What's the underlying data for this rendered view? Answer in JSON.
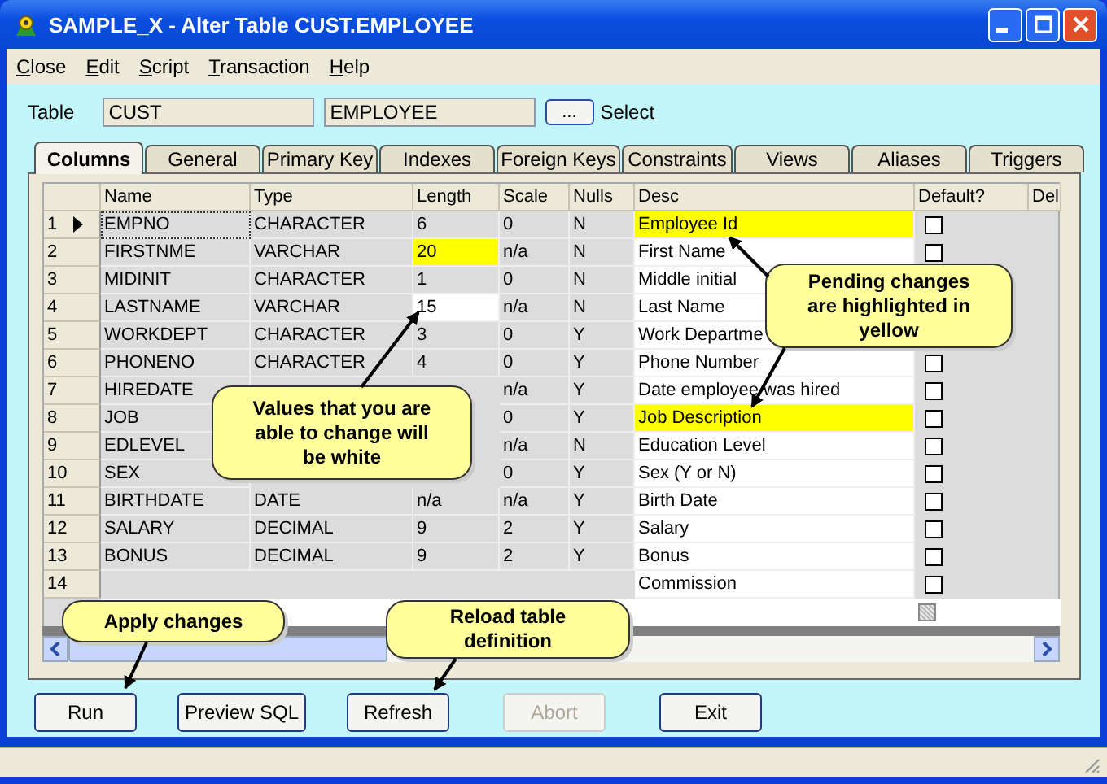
{
  "window": {
    "title": "SAMPLE_X - Alter Table CUST.EMPLOYEE"
  },
  "menu": [
    {
      "accel": "C",
      "rest": "lose"
    },
    {
      "accel": "E",
      "rest": "dit"
    },
    {
      "accel": "S",
      "rest": "cript"
    },
    {
      "accel": "T",
      "rest": "ransaction"
    },
    {
      "accel": "H",
      "rest": "elp"
    }
  ],
  "table_selector": {
    "label": "Table",
    "schema": "CUST",
    "table": "EMPLOYEE",
    "browse_button": "...",
    "browse_label": "Select"
  },
  "tabs": [
    {
      "label": "Columns",
      "selected": true
    },
    {
      "label": "General",
      "selected": false
    },
    {
      "label": "Primary Key",
      "selected": false
    },
    {
      "label": "Indexes",
      "selected": false
    },
    {
      "label": "Foreign Keys",
      "selected": false
    },
    {
      "label": "Constraints",
      "selected": false
    },
    {
      "label": "Views",
      "selected": false
    },
    {
      "label": "Aliases",
      "selected": false
    },
    {
      "label": "Triggers",
      "selected": false
    }
  ],
  "grid": {
    "columns": [
      "Name",
      "Type",
      "Length",
      "Scale",
      "Nulls",
      "Desc",
      "Default?",
      "Del"
    ],
    "rows": [
      {
        "num": "1",
        "current": true,
        "name": "EMPNO",
        "type": "CHARACTER",
        "length": "6",
        "length_editable": false,
        "length_pending": false,
        "scale": "0",
        "nulls": "N",
        "desc": "Employee Id",
        "desc_pending": true,
        "default": false
      },
      {
        "num": "2",
        "current": false,
        "name": "FIRSTNME",
        "type": "VARCHAR",
        "length": "20",
        "length_editable": true,
        "length_pending": true,
        "scale": "n/a",
        "nulls": "N",
        "desc": "First Name",
        "desc_pending": false,
        "default": false
      },
      {
        "num": "3",
        "current": false,
        "name": "MIDINIT",
        "type": "CHARACTER",
        "length": "1",
        "length_editable": false,
        "length_pending": false,
        "scale": "0",
        "nulls": "N",
        "desc": "Middle initial",
        "desc_pending": false
      },
      {
        "num": "4",
        "current": false,
        "name": "LASTNAME",
        "type": "VARCHAR",
        "length": "15",
        "length_editable": true,
        "length_pending": false,
        "scale": "n/a",
        "nulls": "N",
        "desc": "Last Name",
        "desc_pending": false
      },
      {
        "num": "5",
        "current": false,
        "name": "WORKDEPT",
        "type": "CHARACTER",
        "length": "3",
        "length_editable": false,
        "length_pending": false,
        "scale": "0",
        "nulls": "Y",
        "desc": "Work Departme",
        "desc_pending": false
      },
      {
        "num": "6",
        "current": false,
        "name": "PHONENO",
        "type": "CHARACTER",
        "length": "4",
        "length_editable": false,
        "length_pending": false,
        "scale": "0",
        "nulls": "Y",
        "desc": "Phone Number",
        "desc_pending": false,
        "default": false
      },
      {
        "num": "7",
        "current": false,
        "name": "HIREDATE",
        "scale": "n/a",
        "nulls": "Y",
        "desc": "Date employee was hired",
        "desc_pending": false,
        "default": false
      },
      {
        "num": "8",
        "current": false,
        "name": "JOB",
        "scale": "0",
        "nulls": "Y",
        "desc": "Job Description",
        "desc_pending": true,
        "default": false
      },
      {
        "num": "9",
        "current": false,
        "name": "EDLEVEL",
        "scale": "n/a",
        "nulls": "N",
        "desc": "Education Level",
        "desc_pending": false,
        "default": false
      },
      {
        "num": "10",
        "current": false,
        "name": "SEX",
        "scale": "0",
        "nulls": "Y",
        "desc": "Sex (Y or N)",
        "desc_pending": false,
        "default": false
      },
      {
        "num": "11",
        "current": false,
        "name": "BIRTHDATE",
        "type": "DATE",
        "length": "n/a",
        "length_editable": false,
        "length_pending": false,
        "scale": "n/a",
        "nulls": "Y",
        "desc": "Birth Date",
        "desc_pending": false,
        "default": false
      },
      {
        "num": "12",
        "current": false,
        "name": "SALARY",
        "type": "DECIMAL",
        "length": "9",
        "length_editable": false,
        "length_pending": false,
        "scale": "2",
        "nulls": "Y",
        "desc": "Salary",
        "desc_pending": false,
        "default": false
      },
      {
        "num": "13",
        "current": false,
        "name": "BONUS",
        "type": "DECIMAL",
        "length": "9",
        "length_editable": false,
        "length_pending": false,
        "scale": "2",
        "nulls": "Y",
        "desc": "Bonus",
        "desc_pending": false,
        "default": false
      },
      {
        "num": "14",
        "current": false,
        "desc": "Commission",
        "desc_pending": false,
        "default": false
      }
    ],
    "new_row": {
      "default_disabled": true
    }
  },
  "buttons": [
    {
      "label": "Run",
      "disabled": false
    },
    {
      "label": "Preview SQL",
      "disabled": false
    },
    {
      "label": "Refresh",
      "disabled": false
    },
    {
      "label": "Abort",
      "disabled": true
    },
    {
      "label": "Exit",
      "disabled": false
    }
  ],
  "callouts": [
    {
      "text": "Pending changes are highlighted in yellow"
    },
    {
      "text": "Values that you are able to change will be white"
    },
    {
      "text": "Apply changes"
    },
    {
      "text": "Reload table definition"
    }
  ]
}
